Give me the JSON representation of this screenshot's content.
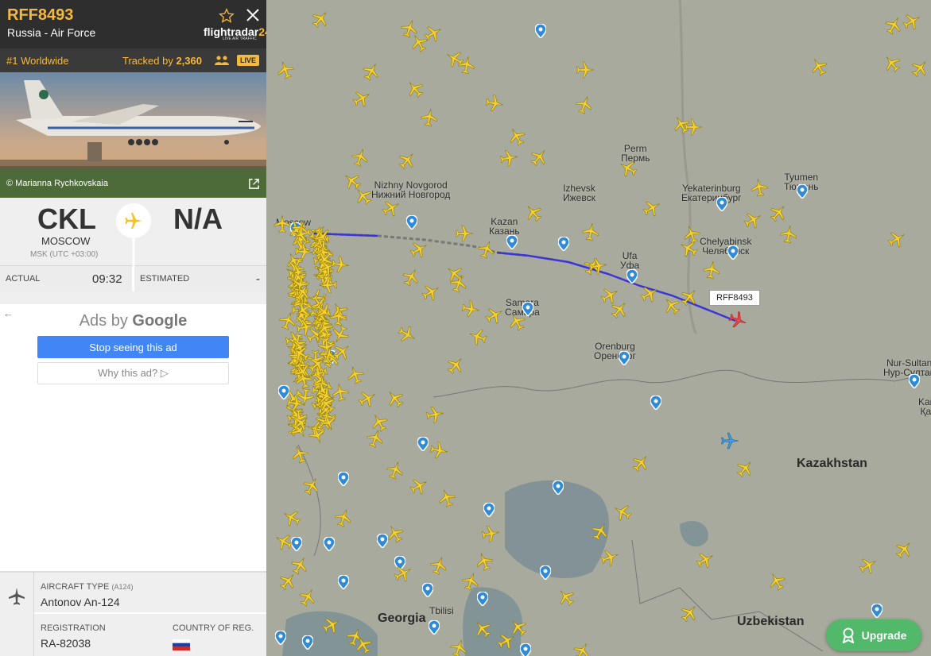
{
  "flight": {
    "callsign": "RFF8493",
    "operator": "Russia - Air Force",
    "rank": "#1 Worldwide",
    "tracked_label": "Tracked by",
    "tracked_count": "2,360",
    "live_badge": "LIVE",
    "brand": "flightradar",
    "brand_num": "24",
    "brand_sub": "LIVE AIR TRAFFIC",
    "photo_credit": "© Marianna Rychkovskaia",
    "origin_code": "CKL",
    "origin_city": "MOSCOW",
    "origin_tz": "MSK (UTC +03:00)",
    "destination_code": "N/A",
    "actual_label": "ACTUAL",
    "actual_time": "09:32",
    "estimated_label": "ESTIMATED",
    "estimated_time": "-"
  },
  "ads": {
    "title_prefix": "Ads by",
    "title_brand": "Google",
    "stop_button": "Stop seeing this ad",
    "why_button": "Why this ad? ▷"
  },
  "aircraft": {
    "type_label": "AIRCRAFT TYPE",
    "type_code": "(A124)",
    "type_value": "Antonov An-124",
    "registration_label": "REGISTRATION",
    "registration_value": "RA-82038",
    "country_label": "COUNTRY OF REG."
  },
  "map": {
    "callout": "RFF8493",
    "upgrade_button": "Upgrade",
    "cities": [
      {
        "name": "Perm",
        "alt": "Пермь"
      },
      {
        "name": "Nizhny Novgorod",
        "alt": "Нижний Новгород"
      },
      {
        "name": "Izhevsk",
        "alt": "Ижевск"
      },
      {
        "name": "Kazan",
        "alt": "Казань"
      },
      {
        "name": "Yekaterinburg",
        "alt": "Екатеринбург"
      },
      {
        "name": "Tyumen",
        "alt": "Тюмень"
      },
      {
        "name": "Moscow",
        "alt": ""
      },
      {
        "name": "Chelyabinsk",
        "alt": "Челябинск"
      },
      {
        "name": "Ufa",
        "alt": "Уфа"
      },
      {
        "name": "Samara",
        "alt": "Самара"
      },
      {
        "name": "Orenburg",
        "alt": "Оренбург"
      },
      {
        "name": "Nur-Sultan",
        "alt": "Нур-Султан"
      },
      {
        "name": "Kara",
        "alt": "Қар"
      },
      {
        "name": "Georgia",
        "alt": ""
      },
      {
        "name": "Tbilisi",
        "alt": ""
      }
    ],
    "countries": [
      "Kazakhstan",
      "Uzbekistan"
    ]
  },
  "colors": {
    "accent": "#f6b93b",
    "header_bg": "#2e2e2e",
    "track": "#3b35d8",
    "selected_plane": "#e8474b",
    "upgrade": "#52b86a",
    "ads_button": "#4285f4"
  }
}
